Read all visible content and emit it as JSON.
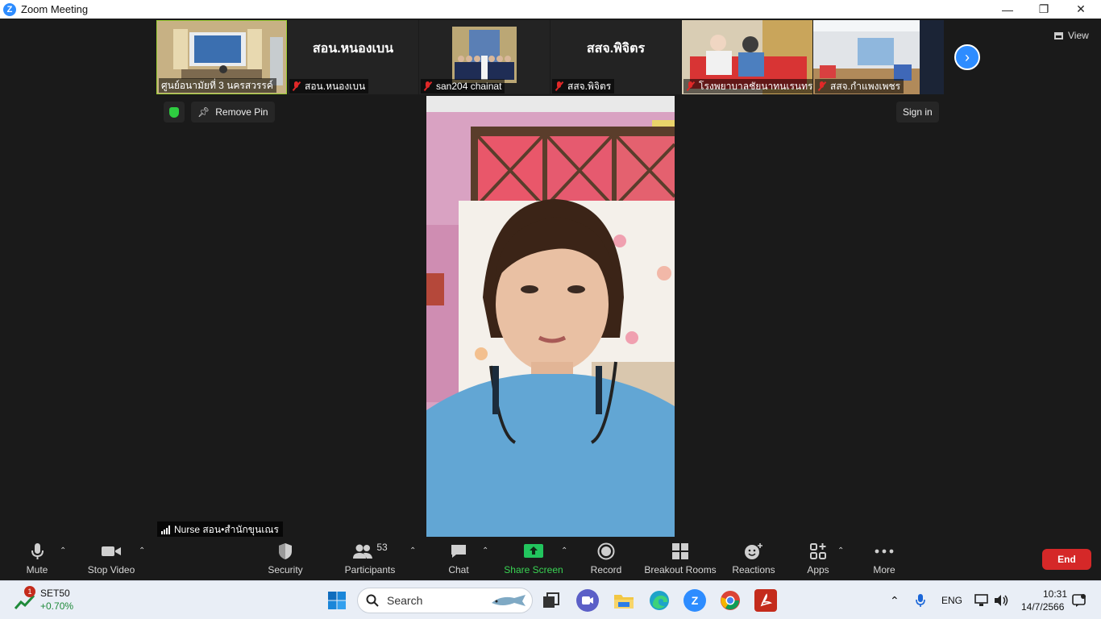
{
  "window": {
    "title": "Zoom Meeting",
    "minimize": "—",
    "restore": "❐",
    "close": "✕"
  },
  "gallery": {
    "tiles": [
      {
        "name": "ศูนย์อนามัยที่ 3 นครสวรรค์",
        "muted": false,
        "kind": "video"
      },
      {
        "name": "สอน.หนองเบน",
        "display": "สอน.หนองเบน",
        "muted": true,
        "kind": "name"
      },
      {
        "name": "san204 chainat",
        "muted": true,
        "kind": "video"
      },
      {
        "name": "สสจ.พิจิตร",
        "display": "สสจ.พิจิตร",
        "muted": true,
        "kind": "name"
      },
      {
        "name": "โรงพยาบาลชัยนาทนเรนทร",
        "muted": true,
        "kind": "video"
      },
      {
        "name": "สสจ.กำแพงเพชร",
        "muted": true,
        "kind": "video"
      }
    ],
    "view_label": "View"
  },
  "controls": {
    "remove_pin": "Remove Pin",
    "sign_in": "Sign in"
  },
  "active_speaker": {
    "name": "Nurse สอน•สำนักขุนเณร"
  },
  "toolbar": {
    "mute": "Mute",
    "stop_video": "Stop Video",
    "security": "Security",
    "participants": "Participants",
    "participants_count": "53",
    "chat": "Chat",
    "share_screen": "Share Screen",
    "record": "Record",
    "breakout_rooms": "Breakout Rooms",
    "reactions": "Reactions",
    "apps": "Apps",
    "more": "More",
    "end": "End"
  },
  "taskbar": {
    "stock_name": "SET50",
    "stock_change": "+0.70%",
    "stock_badge": "1",
    "search_label": "Search",
    "language": "ENG",
    "time": "10:31",
    "date": "14/7/2566"
  },
  "colors": {
    "accent": "#2d8cff",
    "end": "#d52828",
    "share": "#22c55e"
  }
}
